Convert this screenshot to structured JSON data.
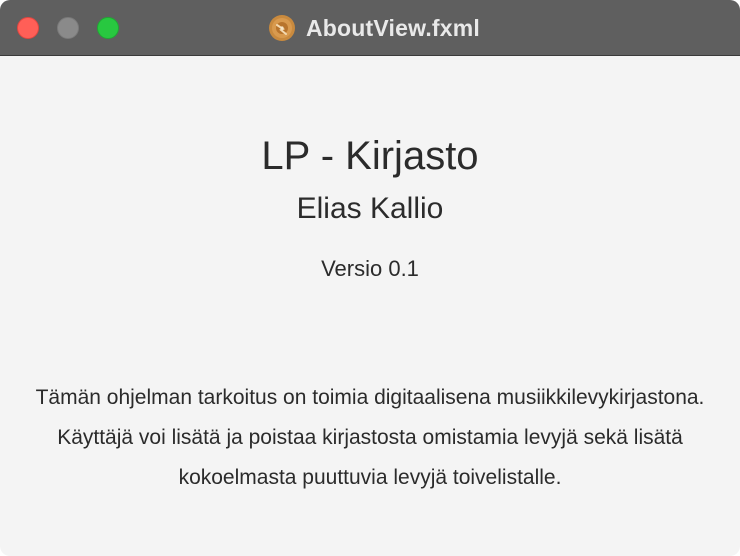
{
  "window": {
    "title": "AboutView.fxml",
    "app_icon": "lp-record-icon"
  },
  "about": {
    "app_name": "LP - Kirjasto",
    "author": "Elias Kallio",
    "version": "Versio 0.1",
    "description": "Tämän ohjelman tarkoitus on toimia digitaalisena musiikkilevykirjastona. Käyttäjä voi lisätä ja poistaa kirjastosta omistamia levyjä sekä lisätä kokoelmasta puuttuvia levyjä toivelistalle."
  },
  "colors": {
    "titlebar": "#5f5f5f",
    "background": "#f4f4f4",
    "text": "#2b2b2b",
    "close": "#ff5f57",
    "minimize_inactive": "#8a8a8a",
    "maximize": "#28c840"
  }
}
